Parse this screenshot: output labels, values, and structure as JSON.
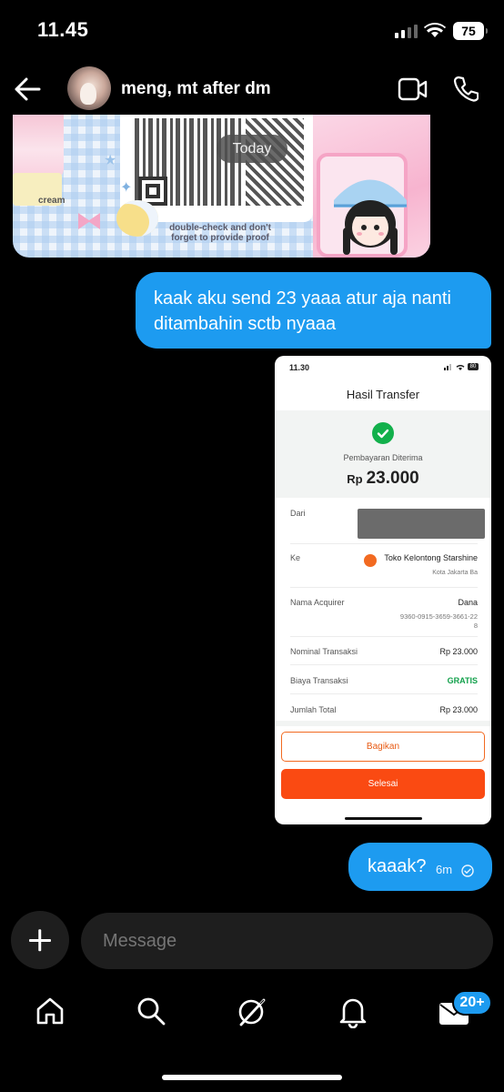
{
  "status_bar": {
    "time": "11.45",
    "battery": "75"
  },
  "header": {
    "title": "meng, mt after dm"
  },
  "shared_post": {
    "label": "Today",
    "caption_left": "cream",
    "caption_note": "double-check and don't forget to provide proof"
  },
  "messages": [
    {
      "text": "kaak aku send 23 yaaa atur aja nanti ditambahin sctb nyaaa"
    },
    {
      "text": "kaaak?",
      "time": "6m"
    }
  ],
  "receipt": {
    "time": "11.30",
    "battery": "80",
    "title": "Hasil Transfer",
    "status": "Pembayaran Diterima",
    "currency": "Rp",
    "amount": "23.000",
    "rows": {
      "from_label": "Dari",
      "to_label": "Ke",
      "to_name": "Toko Kelontong Starshine",
      "to_city": "Kota Jakarta Ba",
      "acquirer_label": "Nama Acquirer",
      "acquirer_value": "Dana",
      "acquirer_id_1": "9360-0915-3659-3661-22",
      "acquirer_id_2": "8",
      "nominal_label": "Nominal Transaksi",
      "nominal_value": "Rp 23.000",
      "fee_label": "Biaya Transaksi",
      "fee_value": "GRATIS",
      "total_label": "Jumlah Total",
      "total_value": "Rp 23.000"
    },
    "share_button": "Bagikan",
    "done_button": "Selesai"
  },
  "composer": {
    "placeholder": "Message"
  },
  "nav": {
    "badge": "20+"
  },
  "colors": {
    "accent": "#1d9bf0",
    "background": "#000000",
    "success": "#12b04b",
    "receipt_orange": "#fa4a12"
  }
}
